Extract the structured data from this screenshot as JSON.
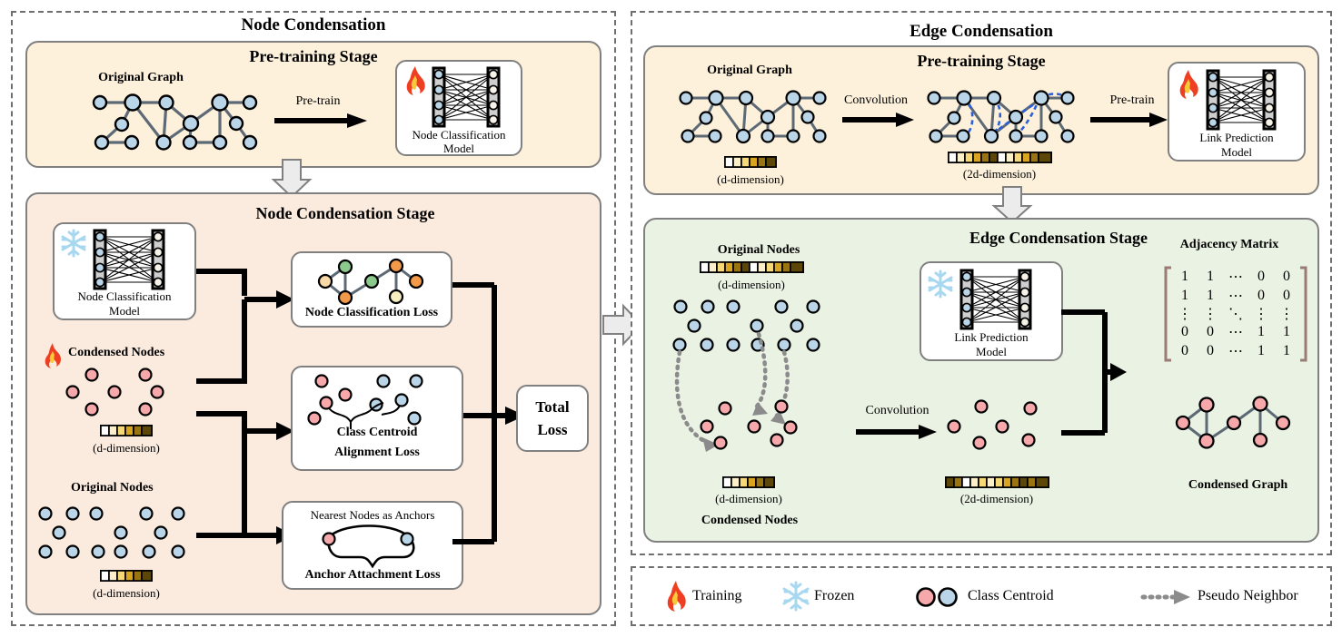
{
  "figure": {
    "left_panel_title": "Node Condensation",
    "right_panel_title": "Edge Condensation"
  },
  "node_panel": {
    "pretrain_stage": {
      "title": "Pre-training Stage",
      "graph_label": "Original Graph",
      "arrow_label": "Pre-train",
      "model_line1": "Node Classification",
      "model_line2": "Model",
      "model_state_icon": "flame-icon"
    },
    "condensation_stage": {
      "title": "Node Condensation Stage",
      "model_line1": "Node Classification",
      "model_line2": "Model",
      "model_state_icon": "snowflake-icon",
      "condensed_nodes_label": "Condensed Nodes",
      "condensed_nodes_icon": "flame-icon",
      "condensed_dim_label": "(d-dimension)",
      "original_nodes_label": "Original Nodes",
      "original_dim_label": "(d-dimension)",
      "loss_boxes": [
        {
          "caption": "Node Classification Loss"
        },
        {
          "caption_line1": "Class Centroid",
          "caption_line2": "Alignment Loss"
        },
        {
          "top_caption": "Nearest Nodes as Anchors",
          "caption": "Anchor Attachment Loss"
        }
      ],
      "total_loss_line1": "Total",
      "total_loss_line2": "Loss"
    }
  },
  "edge_panel": {
    "pretrain_stage": {
      "title": "Pre-training Stage",
      "graph_label": "Original Graph",
      "graph_dim_label": "(d-dimension)",
      "arrow1_label": "Convolution",
      "conv_dim_label": "(2d-dimension)",
      "arrow2_label": "Pre-train",
      "model_line1": "Link  Prediction",
      "model_line2": "Model",
      "model_state_icon": "flame-icon"
    },
    "condensation_stage": {
      "title": "Edge Condensation Stage",
      "original_nodes_label": "Original Nodes",
      "original_dim_label": "(d-dimension)",
      "condensed_dim_label": "(d-dimension)",
      "condensed_nodes_label": "Condensed Nodes",
      "model_line1": "Link Prediction",
      "model_line2": "Model",
      "model_state_icon": "snowflake-icon",
      "arrow_label": "Convolution",
      "conv_dim_label": "(2d-dimension)",
      "adjacency_title": "Adjacency Matrix",
      "adjacency_rows": [
        [
          "1",
          "1",
          "⋯",
          "0",
          "0"
        ],
        [
          "1",
          "1",
          "⋯",
          "0",
          "0"
        ],
        [
          "⋮",
          "⋮",
          "⋱",
          "⋮",
          "⋮"
        ],
        [
          "0",
          "0",
          "⋯",
          "1",
          "1"
        ],
        [
          "0",
          "0",
          "⋯",
          "1",
          "1"
        ]
      ],
      "condensed_graph_label": "Condensed Graph"
    }
  },
  "legend": {
    "items": [
      {
        "icon": "flame-icon",
        "label": "Training"
      },
      {
        "icon": "snowflake-icon",
        "label": "Frozen"
      },
      {
        "icon": "two-circles-icon",
        "label": "Class Centroid"
      },
      {
        "icon": "dotted-arrow-icon",
        "label": "Pseudo Neighbor"
      }
    ]
  },
  "colors": {
    "pretrain_bg": "#fdf1dc",
    "node_cond_bg": "#fbeade",
    "edge_cond_bg": "#e9f2e3",
    "border_gray": "#808080",
    "node_blue": "#bad5e8",
    "node_pink": "#f6a8ab",
    "edge_gray": "#5d6a75",
    "flame_red": "#ef3f22",
    "snow_blue": "#a8d8ef",
    "pseudo_gray": "#8b8b8b",
    "dim_bar_palette": [
      "#ffffff",
      "#fdf0c8",
      "#f7d877",
      "#d9a520",
      "#9a7410",
      "#5d4708"
    ],
    "class_green": "#8cc98c",
    "class_orange": "#f2994a",
    "class_peach": "#fad9a8",
    "class_cream": "#f7efc0",
    "matrix_bracket": "#9a7b76"
  }
}
